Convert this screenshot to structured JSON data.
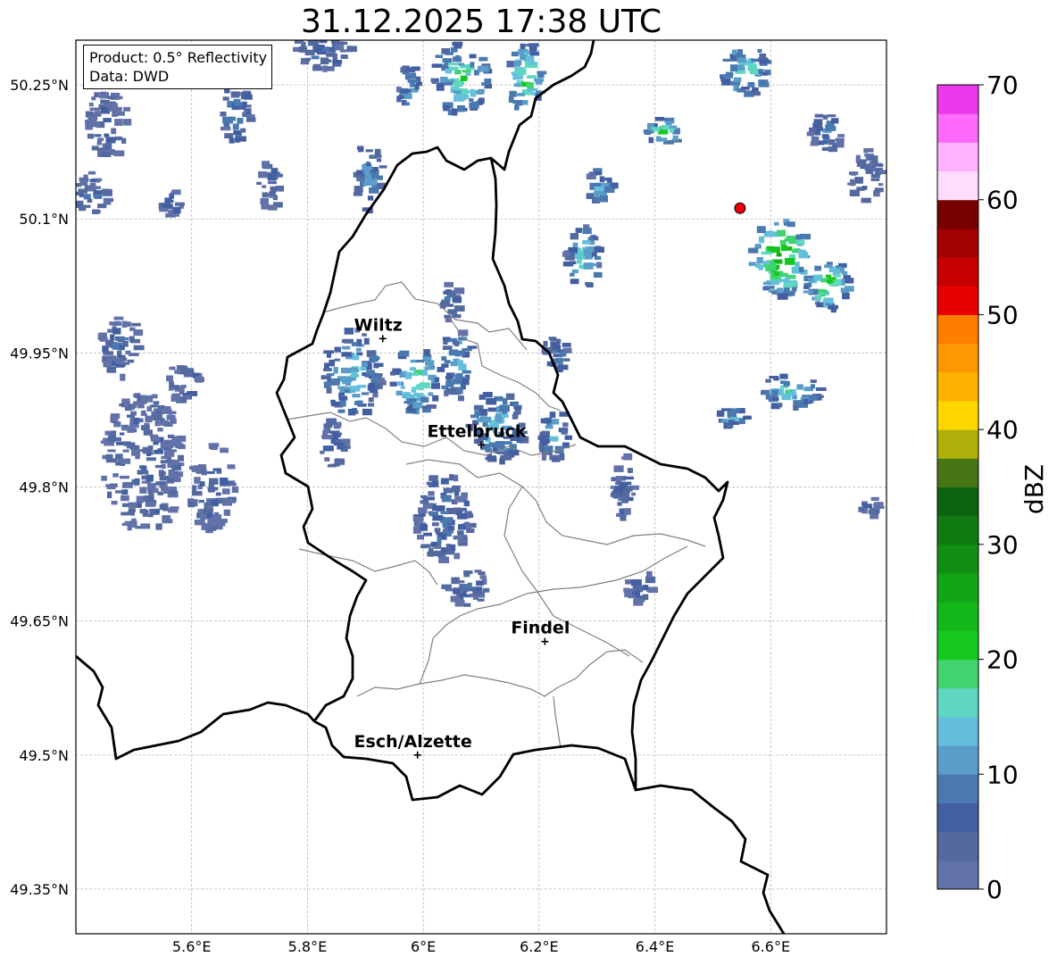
{
  "title": "31.12.2025 17:38 UTC",
  "info": {
    "product": "Product: 0.5° Reflectivity",
    "data": "Data: DWD"
  },
  "axes": {
    "lon_min": 5.4,
    "lon_max": 6.8,
    "lat_min": 49.3,
    "lat_max": 50.3,
    "lon_ticks": [
      {
        "value": 5.6,
        "label": "5.6°E"
      },
      {
        "value": 5.8,
        "label": "5.8°E"
      },
      {
        "value": 6.0,
        "label": "6°E"
      },
      {
        "value": 6.2,
        "label": "6.2°E"
      },
      {
        "value": 6.4,
        "label": "6.4°E"
      },
      {
        "value": 6.6,
        "label": "6.6°E"
      }
    ],
    "lat_ticks": [
      {
        "value": 50.25,
        "label": "50.25°N"
      },
      {
        "value": 50.1,
        "label": "50.1°N"
      },
      {
        "value": 49.95,
        "label": "49.95°N"
      },
      {
        "value": 49.8,
        "label": "49.8°N"
      },
      {
        "value": 49.65,
        "label": "49.65°N"
      },
      {
        "value": 49.5,
        "label": "49.5°N"
      },
      {
        "value": 49.35,
        "label": "49.35°N"
      }
    ]
  },
  "cities": [
    {
      "name": "Wiltz",
      "lon": 5.93,
      "lat": 49.966
    },
    {
      "name": "Ettelbruck",
      "lon": 6.1,
      "lat": 49.847
    },
    {
      "name": "Findel",
      "lon": 6.21,
      "lat": 49.627
    },
    {
      "name": "Esch/Alzette",
      "lon": 5.99,
      "lat": 49.5
    }
  ],
  "radar_site": {
    "lon": 6.547,
    "lat": 50.112,
    "color": "#e8000b"
  },
  "colorbar": {
    "label": "dBZ",
    "min": 0,
    "max": 70,
    "tick_labels": [
      "0",
      "10",
      "20",
      "30",
      "40",
      "50",
      "60",
      "70"
    ],
    "colors": [
      "#6272a9",
      "#53699f",
      "#435fa2",
      "#4a79b0",
      "#5a9dc8",
      "#63bfdc",
      "#5ed6c2",
      "#3fd46e",
      "#14c81f",
      "#12b81a",
      "#12a515",
      "#118f13",
      "#0f7a12",
      "#0c6310",
      "#477616",
      "#aeb00a",
      "#fed600",
      "#fdb200",
      "#fd9900",
      "#fe7e00",
      "#e60000",
      "#c60000",
      "#a30000",
      "#770000",
      "#ffdcfd",
      "#ffb2fe",
      "#fd6afc",
      "#eb39ec"
    ]
  },
  "echo_cells": [
    {
      "lon": 5.45,
      "lat": 50.21,
      "rx": 0.035,
      "ry": 0.04,
      "dbz": 4
    },
    {
      "lon": 5.42,
      "lat": 50.13,
      "rx": 0.03,
      "ry": 0.025,
      "dbz": 5
    },
    {
      "lon": 5.56,
      "lat": 50.12,
      "rx": 0.02,
      "ry": 0.015,
      "dbz": 6
    },
    {
      "lon": 5.67,
      "lat": 50.22,
      "rx": 0.025,
      "ry": 0.04,
      "dbz": 8
    },
    {
      "lon": 5.73,
      "lat": 50.14,
      "rx": 0.02,
      "ry": 0.03,
      "dbz": 4
    },
    {
      "lon": 5.82,
      "lat": 50.29,
      "rx": 0.05,
      "ry": 0.02,
      "dbz": 6
    },
    {
      "lon": 5.9,
      "lat": 50.15,
      "rx": 0.025,
      "ry": 0.04,
      "dbz": 9
    },
    {
      "lon": 5.97,
      "lat": 50.25,
      "rx": 0.02,
      "ry": 0.025,
      "dbz": 10
    },
    {
      "lon": 6.06,
      "lat": 50.26,
      "rx": 0.05,
      "ry": 0.04,
      "dbz": 16
    },
    {
      "lon": 6.17,
      "lat": 50.26,
      "rx": 0.03,
      "ry": 0.04,
      "dbz": 18
    },
    {
      "lon": 6.3,
      "lat": 50.14,
      "rx": 0.025,
      "ry": 0.02,
      "dbz": 11
    },
    {
      "lon": 6.27,
      "lat": 50.06,
      "rx": 0.03,
      "ry": 0.035,
      "dbz": 13
    },
    {
      "lon": 6.41,
      "lat": 50.2,
      "rx": 0.03,
      "ry": 0.015,
      "dbz": 17
    },
    {
      "lon": 6.55,
      "lat": 50.27,
      "rx": 0.04,
      "ry": 0.03,
      "dbz": 14
    },
    {
      "lon": 6.69,
      "lat": 50.2,
      "rx": 0.03,
      "ry": 0.02,
      "dbz": 8
    },
    {
      "lon": 6.76,
      "lat": 50.15,
      "rx": 0.03,
      "ry": 0.03,
      "dbz": 6
    },
    {
      "lon": 6.61,
      "lat": 50.06,
      "rx": 0.05,
      "ry": 0.045,
      "dbz": 22
    },
    {
      "lon": 6.69,
      "lat": 50.03,
      "rx": 0.04,
      "ry": 0.03,
      "dbz": 19
    },
    {
      "lon": 6.63,
      "lat": 49.91,
      "rx": 0.05,
      "ry": 0.02,
      "dbz": 14
    },
    {
      "lon": 6.53,
      "lat": 49.88,
      "rx": 0.03,
      "ry": 0.01,
      "dbz": 12
    },
    {
      "lon": 5.47,
      "lat": 49.96,
      "rx": 0.035,
      "ry": 0.035,
      "dbz": 5
    },
    {
      "lon": 5.51,
      "lat": 49.83,
      "rx": 0.07,
      "ry": 0.08,
      "dbz": 4
    },
    {
      "lon": 5.63,
      "lat": 49.8,
      "rx": 0.04,
      "ry": 0.05,
      "dbz": 4
    },
    {
      "lon": 5.58,
      "lat": 49.92,
      "rx": 0.03,
      "ry": 0.02,
      "dbz": 5
    },
    {
      "lon": 5.87,
      "lat": 49.93,
      "rx": 0.05,
      "ry": 0.05,
      "dbz": 12
    },
    {
      "lon": 5.98,
      "lat": 49.92,
      "rx": 0.04,
      "ry": 0.04,
      "dbz": 16
    },
    {
      "lon": 6.05,
      "lat": 49.94,
      "rx": 0.03,
      "ry": 0.04,
      "dbz": 11
    },
    {
      "lon": 6.12,
      "lat": 49.87,
      "rx": 0.05,
      "ry": 0.04,
      "dbz": 12
    },
    {
      "lon": 6.22,
      "lat": 49.86,
      "rx": 0.025,
      "ry": 0.03,
      "dbz": 11
    },
    {
      "lon": 6.22,
      "lat": 49.95,
      "rx": 0.025,
      "ry": 0.02,
      "dbz": 8
    },
    {
      "lon": 6.04,
      "lat": 50.01,
      "rx": 0.02,
      "ry": 0.02,
      "dbz": 7
    },
    {
      "lon": 6.03,
      "lat": 49.77,
      "rx": 0.05,
      "ry": 0.05,
      "dbz": 6
    },
    {
      "lon": 5.84,
      "lat": 49.85,
      "rx": 0.02,
      "ry": 0.03,
      "dbz": 5
    },
    {
      "lon": 6.07,
      "lat": 49.69,
      "rx": 0.04,
      "ry": 0.02,
      "dbz": 5
    },
    {
      "lon": 6.34,
      "lat": 49.8,
      "rx": 0.02,
      "ry": 0.04,
      "dbz": 4
    },
    {
      "lon": 6.37,
      "lat": 49.69,
      "rx": 0.025,
      "ry": 0.02,
      "dbz": 4
    },
    {
      "lon": 6.77,
      "lat": 49.78,
      "rx": 0.02,
      "ry": 0.01,
      "dbz": 4
    }
  ]
}
